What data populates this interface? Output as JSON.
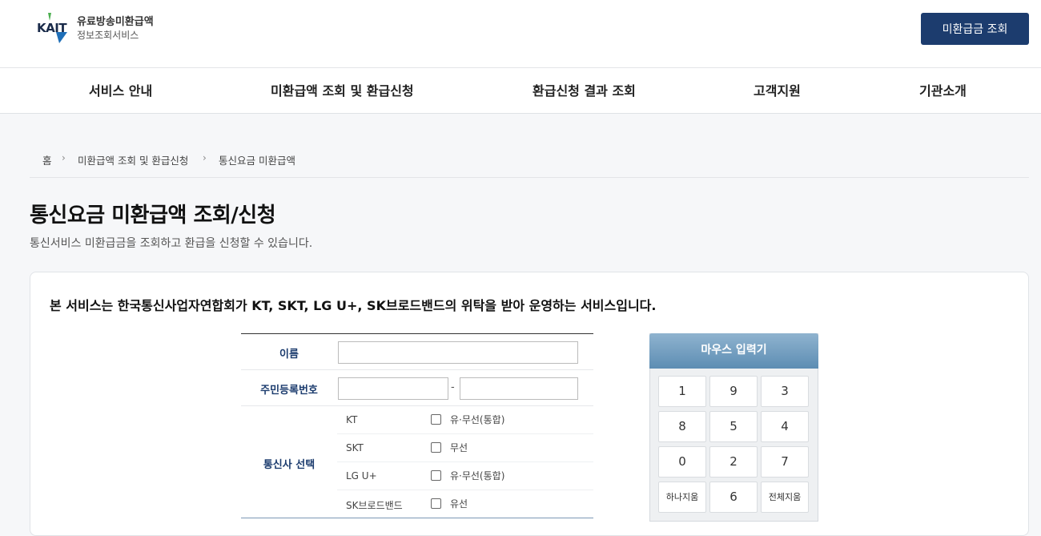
{
  "header": {
    "logo_kait": "KAIT",
    "logo_line1": "유료방송미환급액",
    "logo_line2": "정보조회서비스",
    "lookup_button": "미환급금 조회"
  },
  "gnb": [
    "서비스 안내",
    "미환급액 조회 및 환급신청",
    "환급신청 결과 조회",
    "고객지원",
    "기관소개"
  ],
  "breadcrumb": [
    "홈",
    "미환급액 조회 및 환급신청",
    "통신요금 미환급액"
  ],
  "page": {
    "title": "통신요금 미환급액 조회/신청",
    "description": "통신서비스 미환급금을 조회하고 환급을 신청할 수 있습니다."
  },
  "notice": "본 서비스는 한국통신사업자연합회가 KT, SKT, LG U+, SK브로드밴드의 위탁을 받아 운영하는 서비스입니다.",
  "form": {
    "name_label": "이름",
    "name_value": "",
    "jumin_label": "주민등록번호",
    "jumin_front": "",
    "jumin_back": "",
    "jumin_dash": "-",
    "carrier_label": "통신사 선택",
    "carriers": [
      {
        "name": "KT",
        "type": "유·무선(통합)",
        "checked": false
      },
      {
        "name": "SKT",
        "type": "무선",
        "checked": false
      },
      {
        "name": "LG U+",
        "type": "유·무선(통합)",
        "checked": false
      },
      {
        "name": "SK브로드밴드",
        "type": "유선",
        "checked": false
      }
    ]
  },
  "keypad": {
    "title": "마우스 입력기",
    "keys": [
      "1",
      "9",
      "3",
      "8",
      "5",
      "4",
      "0",
      "2",
      "7",
      "하나지움",
      "6",
      "전체지움"
    ]
  },
  "colors": {
    "primary": "#1c3c6e",
    "keypad_head": "#6f9cc0"
  }
}
